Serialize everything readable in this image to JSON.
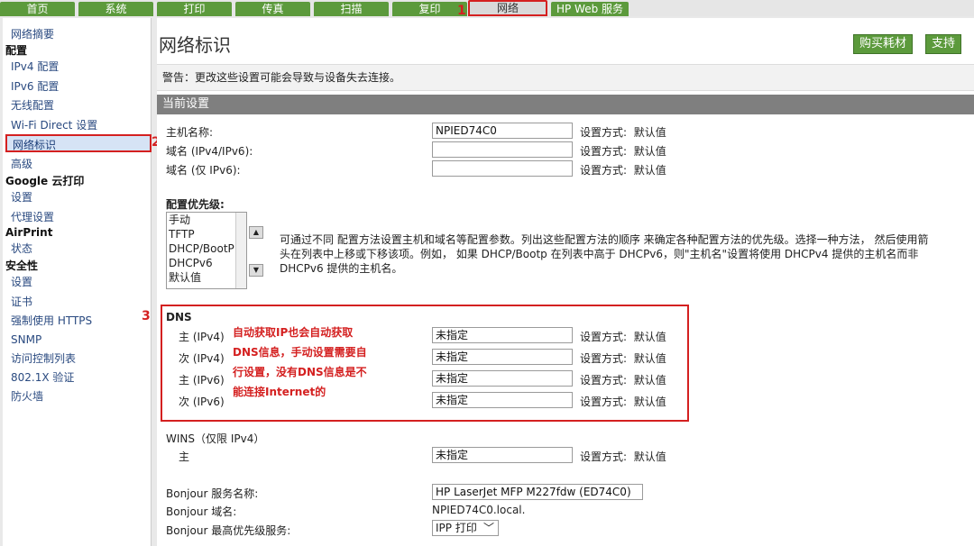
{
  "tabs": [
    {
      "label": "首页",
      "active": false
    },
    {
      "label": "系统",
      "active": false
    },
    {
      "label": "打印",
      "active": false
    },
    {
      "label": "传真",
      "active": false
    },
    {
      "label": "扫描",
      "active": false
    },
    {
      "label": "复印",
      "active": false
    },
    {
      "label": "网络",
      "active": true
    },
    {
      "label": "HP Web 服务",
      "active": false
    }
  ],
  "markers": {
    "m1": "1",
    "m2": "2",
    "m3": "3"
  },
  "sidebar": {
    "items": [
      {
        "label": "网络摘要",
        "kind": "link"
      },
      {
        "label": "配置",
        "kind": "head"
      },
      {
        "label": "IPv4 配置",
        "kind": "link"
      },
      {
        "label": "IPv6 配置",
        "kind": "link"
      },
      {
        "label": "无线配置",
        "kind": "link"
      },
      {
        "label": "Wi-Fi Direct 设置",
        "kind": "link"
      },
      {
        "label": "网络标识",
        "kind": "selected"
      },
      {
        "label": "高级",
        "kind": "link"
      },
      {
        "label": "Google 云打印",
        "kind": "head"
      },
      {
        "label": "设置",
        "kind": "link"
      },
      {
        "label": "代理设置",
        "kind": "link"
      },
      {
        "label": "AirPrint",
        "kind": "head"
      },
      {
        "label": "状态",
        "kind": "link"
      },
      {
        "label": "安全性",
        "kind": "head"
      },
      {
        "label": "设置",
        "kind": "link"
      },
      {
        "label": "证书",
        "kind": "link"
      },
      {
        "label": "强制使用 HTTPS",
        "kind": "link"
      },
      {
        "label": "SNMP",
        "kind": "link"
      },
      {
        "label": "访问控制列表",
        "kind": "link"
      },
      {
        "label": "802.1X 验证",
        "kind": "link"
      },
      {
        "label": "防火墙",
        "kind": "link"
      }
    ]
  },
  "header": {
    "title": "网络标识",
    "buy_supplies": "购买耗材",
    "support": "支持"
  },
  "warning": "警告：更改这些设置可能会导致与设备失去连接。",
  "section_title": "当前设置",
  "config_prefix": "设置方式:",
  "config_value": "默认值",
  "host": {
    "rows": [
      {
        "label": "主机名称:",
        "value": "NPIED74C0"
      },
      {
        "label": "域名 (IPv4/IPv6):",
        "value": ""
      },
      {
        "label": "域名 (仅 IPv6):",
        "value": ""
      }
    ]
  },
  "priority": {
    "label": "配置优先级:",
    "options": [
      "手动",
      "TFTP",
      "DHCP/BootP",
      "DHCPv6",
      "默认值"
    ],
    "up_arrow": "▲",
    "down_arrow": "▼",
    "help": "可通过不同 配置方法设置主机和域名等配置参数。列出这些配置方法的顺序 来确定各种配置方法的优先级。选择一种方法， 然后使用箭头在列表中上移或下移该项。例如， 如果 DHCP/Bootp 在列表中高于 DHCPv6，则\"主机名\"设置将使用 DHCPv4 提供的主机名而非 DHCPv6 提供的主机名。"
  },
  "dns": {
    "title": "DNS",
    "note": "自动获取IP也会自动获取DNS信息，手动设置需要自行设置，没有DNS信息是不能连接Internet的",
    "rows": [
      {
        "label": "主 (IPv4)",
        "value": "未指定"
      },
      {
        "label": "次 (IPv4)",
        "value": "未指定"
      },
      {
        "label": "主 (IPv6)",
        "value": "未指定"
      },
      {
        "label": "次 (IPv6)",
        "value": "未指定"
      }
    ]
  },
  "wins": {
    "title": "WINS（仅限 IPv4）",
    "primary_label": "主",
    "primary_value": "未指定"
  },
  "bonjour": {
    "service_label": "Bonjour 服务名称:",
    "service_value": "HP LaserJet MFP M227fdw (ED74C0)",
    "domain_label": "Bonjour 域名:",
    "domain_value": "NPIED74C0.local.",
    "priority_label": "Bonjour 最高优先级服务:",
    "priority_value": "IPP 打印",
    "caret": "﹀"
  }
}
